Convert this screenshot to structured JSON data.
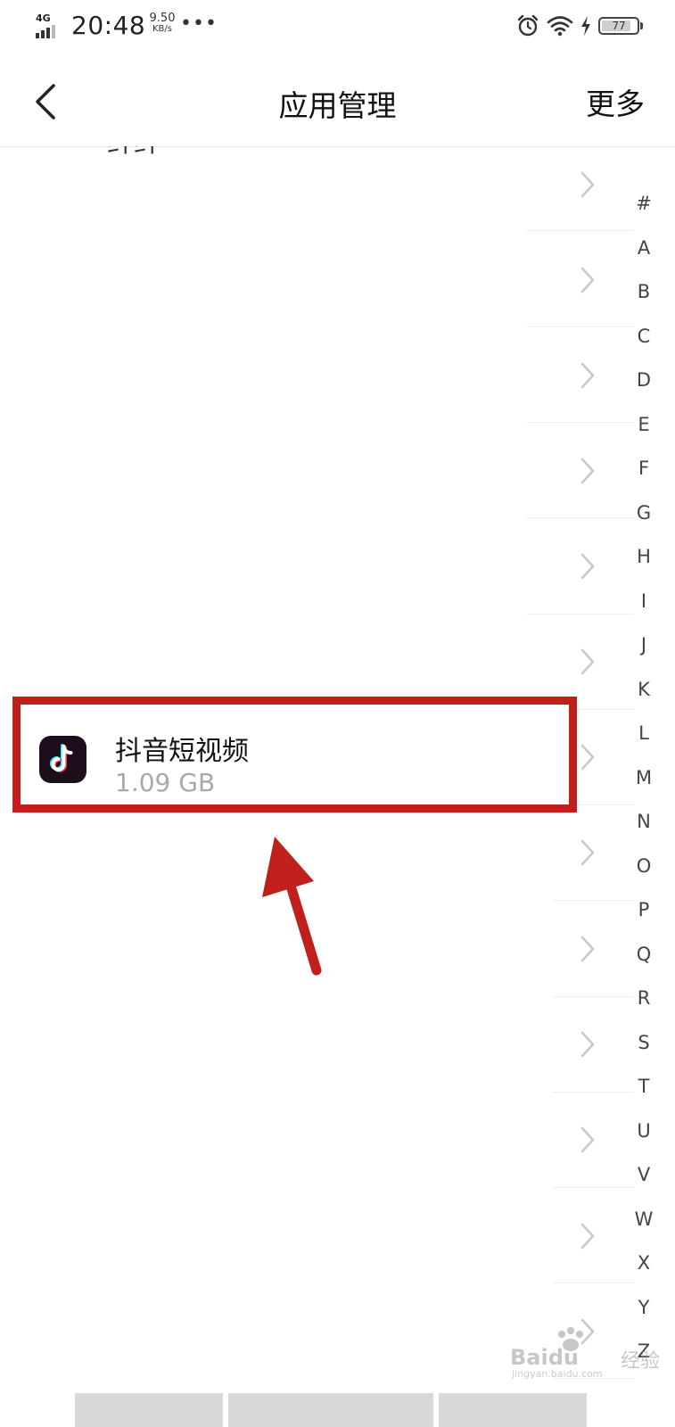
{
  "status_bar": {
    "network": "4G",
    "time": "20:48",
    "speed_value": "9.50",
    "speed_unit": "KB/s",
    "more_dots": "•••",
    "battery": "77",
    "icons": [
      "signal-icon",
      "alarm-icon",
      "wifi-icon",
      "charging-icon",
      "battery-icon"
    ]
  },
  "header": {
    "back_icon": "chevron-left-icon",
    "title": "应用管理",
    "more_label": "更多"
  },
  "list": {
    "partial_top_label": "纤纤",
    "chevron_icon": "chevron-right-icon"
  },
  "highlighted_app": {
    "name": "抖音短视频",
    "size": "1.09 GB",
    "icon": "tiktok-icon",
    "highlight_color": "#c0201b"
  },
  "alphabet_index": [
    "#",
    "A",
    "B",
    "C",
    "D",
    "E",
    "F",
    "G",
    "H",
    "I",
    "J",
    "K",
    "L",
    "M",
    "N",
    "O",
    "P",
    "Q",
    "R",
    "S",
    "T",
    "U",
    "V",
    "W",
    "X",
    "Y",
    "Z"
  ],
  "watermark": {
    "brand": "Baidu",
    "brand_cn": "经验",
    "domain": "jingyan.baidu.com"
  },
  "colors": {
    "annotation_red": "#c0201b",
    "secondary_text": "#a9a9a9"
  }
}
